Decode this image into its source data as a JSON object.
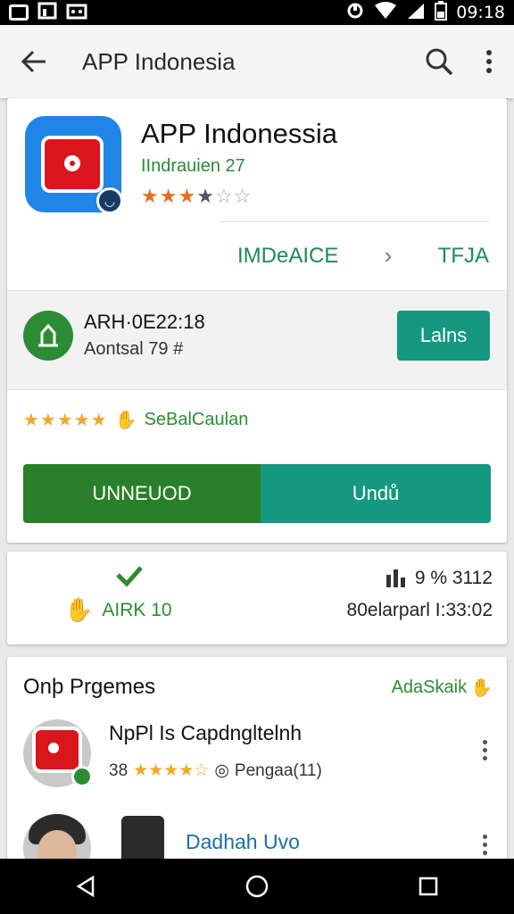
{
  "status_bar": {
    "time": "09:18",
    "icons": [
      "notification-icon",
      "sim-icon",
      "message-icon",
      "sync-icon",
      "wifi-icon",
      "signal-icon",
      "battery-icon"
    ]
  },
  "app_bar": {
    "title": "APP Indonesia",
    "icons": [
      "back-arrow-icon",
      "search-icon",
      "more-vert-icon"
    ]
  },
  "app_header": {
    "name": "APP Indonessia",
    "developer": "IIndrauien 27",
    "rating_stars": "3.5"
  },
  "tabs": {
    "left": "IMDeAICE",
    "right": "TFJA"
  },
  "install_row": {
    "title": "ARH·0E22:18",
    "subtitle": "Aontsal 79 #",
    "button": "Lalns"
  },
  "rating": {
    "label": "SeBalCaulan"
  },
  "actions": {
    "uninstall": "UNNEUOD",
    "open": "Undů"
  },
  "info": {
    "left_label": "AIRK 10",
    "right_line1": "9 % 3112",
    "right_line2": "80elarparl I:33:02"
  },
  "similar": {
    "title": "Onþ Prgemes",
    "more_link": "AdaSkaik",
    "items": [
      {
        "title": "NpPl Is Capdngltelnh",
        "rating": "38",
        "extra": "Pengaa(11)"
      },
      {
        "title": "Dadhah Uvo"
      }
    ]
  },
  "colors": {
    "accent_green": "#2a7f2a",
    "accent_teal": "#14987f",
    "star_orange": "#e76d1e",
    "star_yellow": "#f2a72a",
    "app_icon_blue": "#1f86e8",
    "app_icon_red": "#d9161c"
  }
}
